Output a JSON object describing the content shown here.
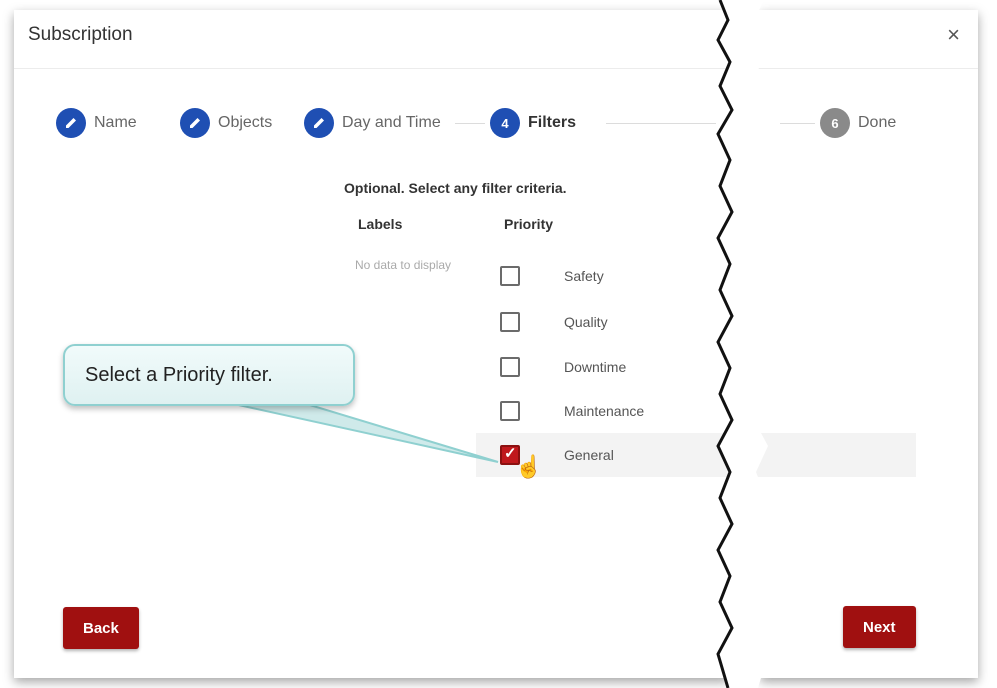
{
  "dialog": {
    "title": "Subscription",
    "close_label": "×"
  },
  "stepper": {
    "steps": [
      {
        "number": "",
        "label": "Name",
        "state": "done"
      },
      {
        "number": "",
        "label": "Objects",
        "state": "done"
      },
      {
        "number": "",
        "label": "Day and Time",
        "state": "done"
      },
      {
        "number": "4",
        "label": "Filters",
        "state": "active"
      },
      {
        "number": "6",
        "label": "Done",
        "state": "pending"
      }
    ]
  },
  "filters": {
    "hint": "Optional. Select any filter criteria.",
    "labels_header": "Labels",
    "priority_header": "Priority",
    "labels_empty": "No data to display",
    "priorities": [
      {
        "label": "Safety",
        "checked": false
      },
      {
        "label": "Quality",
        "checked": false
      },
      {
        "label": "Downtime",
        "checked": false
      },
      {
        "label": "Maintenance",
        "checked": false
      },
      {
        "label": "General",
        "checked": true
      }
    ]
  },
  "buttons": {
    "back": "Back",
    "next": "Next"
  },
  "callout": {
    "text": "Select a Priority filter."
  },
  "colors": {
    "accent": "#1f4fb3",
    "button": "#a01010",
    "checkbox_checked": "#c0181c"
  }
}
